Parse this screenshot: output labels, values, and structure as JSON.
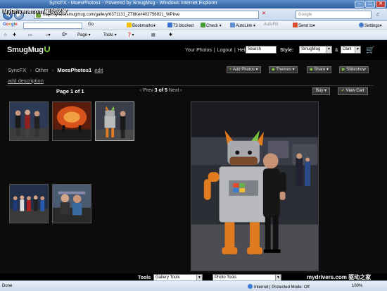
{
  "browser": {
    "title": "SyncFX - MoesPhotos1 - Powered by SmugMug - Windows Internet Explorer",
    "url": "http://syncfx.smugmug.com/gallery/6371131_ZT8Ke#402756921_WPbve",
    "search_placeholder": "Google",
    "url_controls": "✕"
  },
  "google_bar": {
    "search_go": "Go",
    "bookmarks": "Bookmarks▾",
    "blocked": "73 blocked",
    "check": "Check ▾",
    "autolink": "AutoLink ▾",
    "autofill": "AutoFill",
    "send_to": "Send to▾",
    "settings": "Settings▾"
  },
  "command_bar": {
    "page": "Page ▾",
    "tools": "Tools ▾",
    "help": "❓▾"
  },
  "smugmug": {
    "logo": "SmugMug",
    "nav": {
      "your_photos": "Your Photos",
      "sep": "|",
      "logout": "Logout",
      "help": "Help"
    },
    "search_value": "Search",
    "style_label": "Style:",
    "style_value": "SmugMug",
    "amp": "&",
    "theme_value": "Dark",
    "breadcrumb": {
      "root": "SyncFX",
      "category": "Other",
      "gallery": "MoesPhotos1",
      "edit": "edit",
      "sep": "›"
    },
    "add_description": "add description",
    "buttons": {
      "add_photos": "Add Photos ▾",
      "themes": "Themes ▾",
      "share": "Share ▾",
      "slideshow": "Slideshow"
    },
    "pager": "Page 1 of 1",
    "image_nav": {
      "prev": "‹ Prev",
      "current": "3 of 5",
      "next": "Next ›"
    },
    "buy": "Buy ▾",
    "view_cart": "View Cart",
    "tools_label": "Tools",
    "gallery_tools": "Gallery Tools",
    "photo_tools": "Photo Tools"
  },
  "status": {
    "done": "Done",
    "zone": "Internet | Protected Mode: Off",
    "zoom": "100%"
  },
  "watermarks": {
    "left": "MyDrivers.com 驱动之家",
    "right": "mydrivers.com 驱动之家"
  }
}
